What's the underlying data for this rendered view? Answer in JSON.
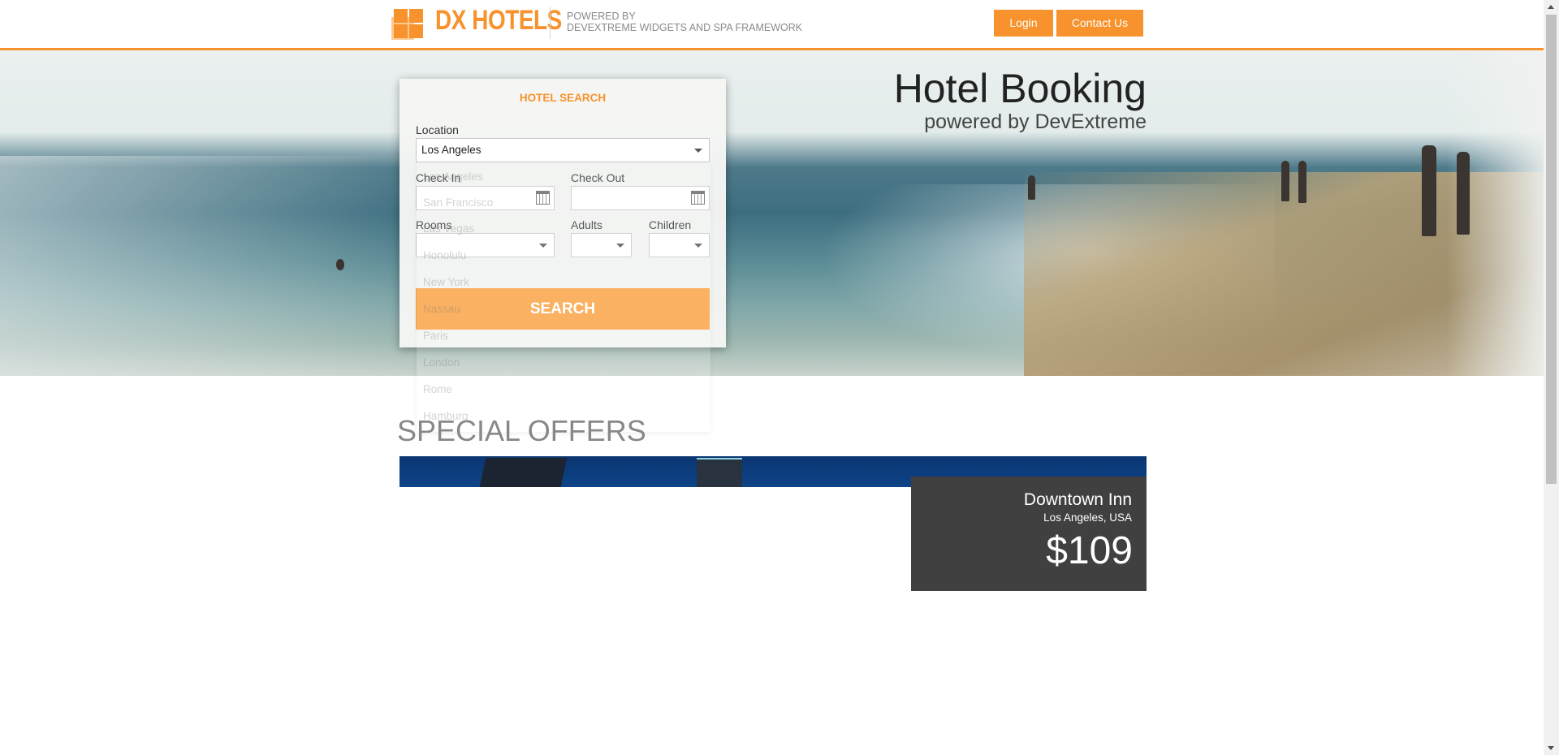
{
  "header": {
    "brand": "DX HOTELS",
    "powered_line1": "POWERED BY",
    "powered_line2": "DEVEXTREME WIDGETS AND SPA FRAMEWORK",
    "login_label": "Login",
    "contact_label": "Contact Us",
    "accent_color": "#f7922c"
  },
  "hero": {
    "title": "Hotel Booking",
    "subtitle": "powered by DevExtreme"
  },
  "search": {
    "heading": "HOTEL SEARCH",
    "location_label": "Location",
    "location_value": "Los Angeles",
    "checkin_label": "Check In",
    "checkout_label": "Check Out",
    "rooms_label": "Rooms",
    "adults_label": "Adults",
    "children_label": "Children",
    "search_button": "SEARCH",
    "location_options": [
      "Los Angeles",
      "San Francisco",
      "Las Vegas",
      "Honolulu",
      "New York",
      "Nassau",
      "Paris",
      "London",
      "Rome",
      "Hamburg"
    ]
  },
  "offers": {
    "title": "SPECIAL OFFERS",
    "items": [
      {
        "name": "Downtown Inn",
        "location": "Los Angeles, USA",
        "price": "$109"
      }
    ]
  },
  "icons": {
    "dropdown": "chevron-down-icon",
    "calendar": "calendar-icon"
  }
}
